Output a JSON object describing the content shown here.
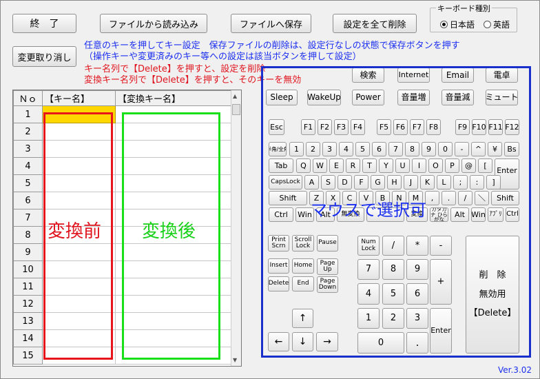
{
  "top": {
    "quit": "終　了",
    "load": "ファイルから読み込み",
    "save": "ファイルへ保存",
    "clear_all": "設定を全て削除",
    "undo": "変更取り消し"
  },
  "keyboard_type": {
    "label": "キーボード種別",
    "japanese": "日本語",
    "english": "英語",
    "selected": "日本語"
  },
  "info": {
    "line1": "任意のキーを押してキー設定　保存ファイルの削除は、設定行なしの状態で保存ボタンを押す",
    "line2": "（操作キーや変更済みのキー等への設定は該当ボタンを押して設定）",
    "line3": "キー名列で【Delete】を押すと、設定を削除",
    "line4": "変換キー名列で【Delete】を押すと、そのキーを無効"
  },
  "grid": {
    "col_no": "Ｎｏ",
    "col_key": "【キー名】",
    "col_conv": "【変換キー名】",
    "rows": [
      "1",
      "2",
      "3",
      "4",
      "5",
      "6",
      "7",
      "8",
      "9",
      "10",
      "11",
      "12",
      "13",
      "14",
      "15"
    ],
    "before_label": "変換前",
    "after_label": "変換後"
  },
  "special": {
    "search": "検索",
    "internet": "Internet",
    "email": "Email",
    "calc": "電卓",
    "sleep": "Sleep",
    "wakeup": "WakeUp",
    "power": "Power",
    "volup": "音量増",
    "voldown": "音量減",
    "mute": "ミュート"
  },
  "keys": {
    "esc": "Esc",
    "f": [
      "F1",
      "F2",
      "F3",
      "F4",
      "F5",
      "F6",
      "F7",
      "F8",
      "F9",
      "F10",
      "F11",
      "F12"
    ],
    "hankaku": "半角/全角",
    "row1": [
      "1",
      "2",
      "3",
      "4",
      "5",
      "6",
      "7",
      "8",
      "9",
      "0",
      "-",
      "^",
      "¥"
    ],
    "bs": "Bs",
    "tab": "Tab",
    "row2": [
      "Q",
      "W",
      "E",
      "R",
      "T",
      "Y",
      "U",
      "I",
      "O",
      "P",
      "@",
      "["
    ],
    "enter": "Enter",
    "caps": "CapsLock",
    "row3": [
      "A",
      "S",
      "D",
      "F",
      "G",
      "H",
      "J",
      "K",
      "L",
      ";",
      ":",
      "]"
    ],
    "shift": "Shift",
    "row4": [
      "Z",
      "X",
      "C",
      "V",
      "B",
      "N",
      "M",
      ",",
      ".",
      "/",
      "＼"
    ],
    "ctrl": "Ctrl",
    "win": "Win",
    "alt": "Alt",
    "muhenkan": "無変換",
    "henkan": "変換",
    "kana": "カタカナ ひらがな",
    "app": "ｱﾌﾟﾘ",
    "printscrn": "Print Scrn",
    "scrolllock": "Scroll Lock",
    "pause": "Pause",
    "insert": "Insert",
    "home": "Home",
    "pageup": "Page Up",
    "delete": "Delete",
    "end": "End",
    "pagedown": "Page Down",
    "up": "↑",
    "left": "←",
    "down": "↓",
    "right": "→",
    "numlock": "Num Lock",
    "slash": "/",
    "star": "*",
    "minus": "-",
    "plus": "+",
    "n7": "7",
    "n8": "8",
    "n9": "9",
    "n4": "4",
    "n5": "5",
    "n6": "6",
    "n1": "1",
    "n2": "2",
    "n3": "3",
    "n0": "0",
    "dot": ".",
    "nenter": "Enter"
  },
  "delete_panel": {
    "line1": "削　除",
    "line2": "無効用",
    "line3": "【Delete】"
  },
  "mouse_note": "マウスで選択可",
  "version": "Ver.3.02"
}
